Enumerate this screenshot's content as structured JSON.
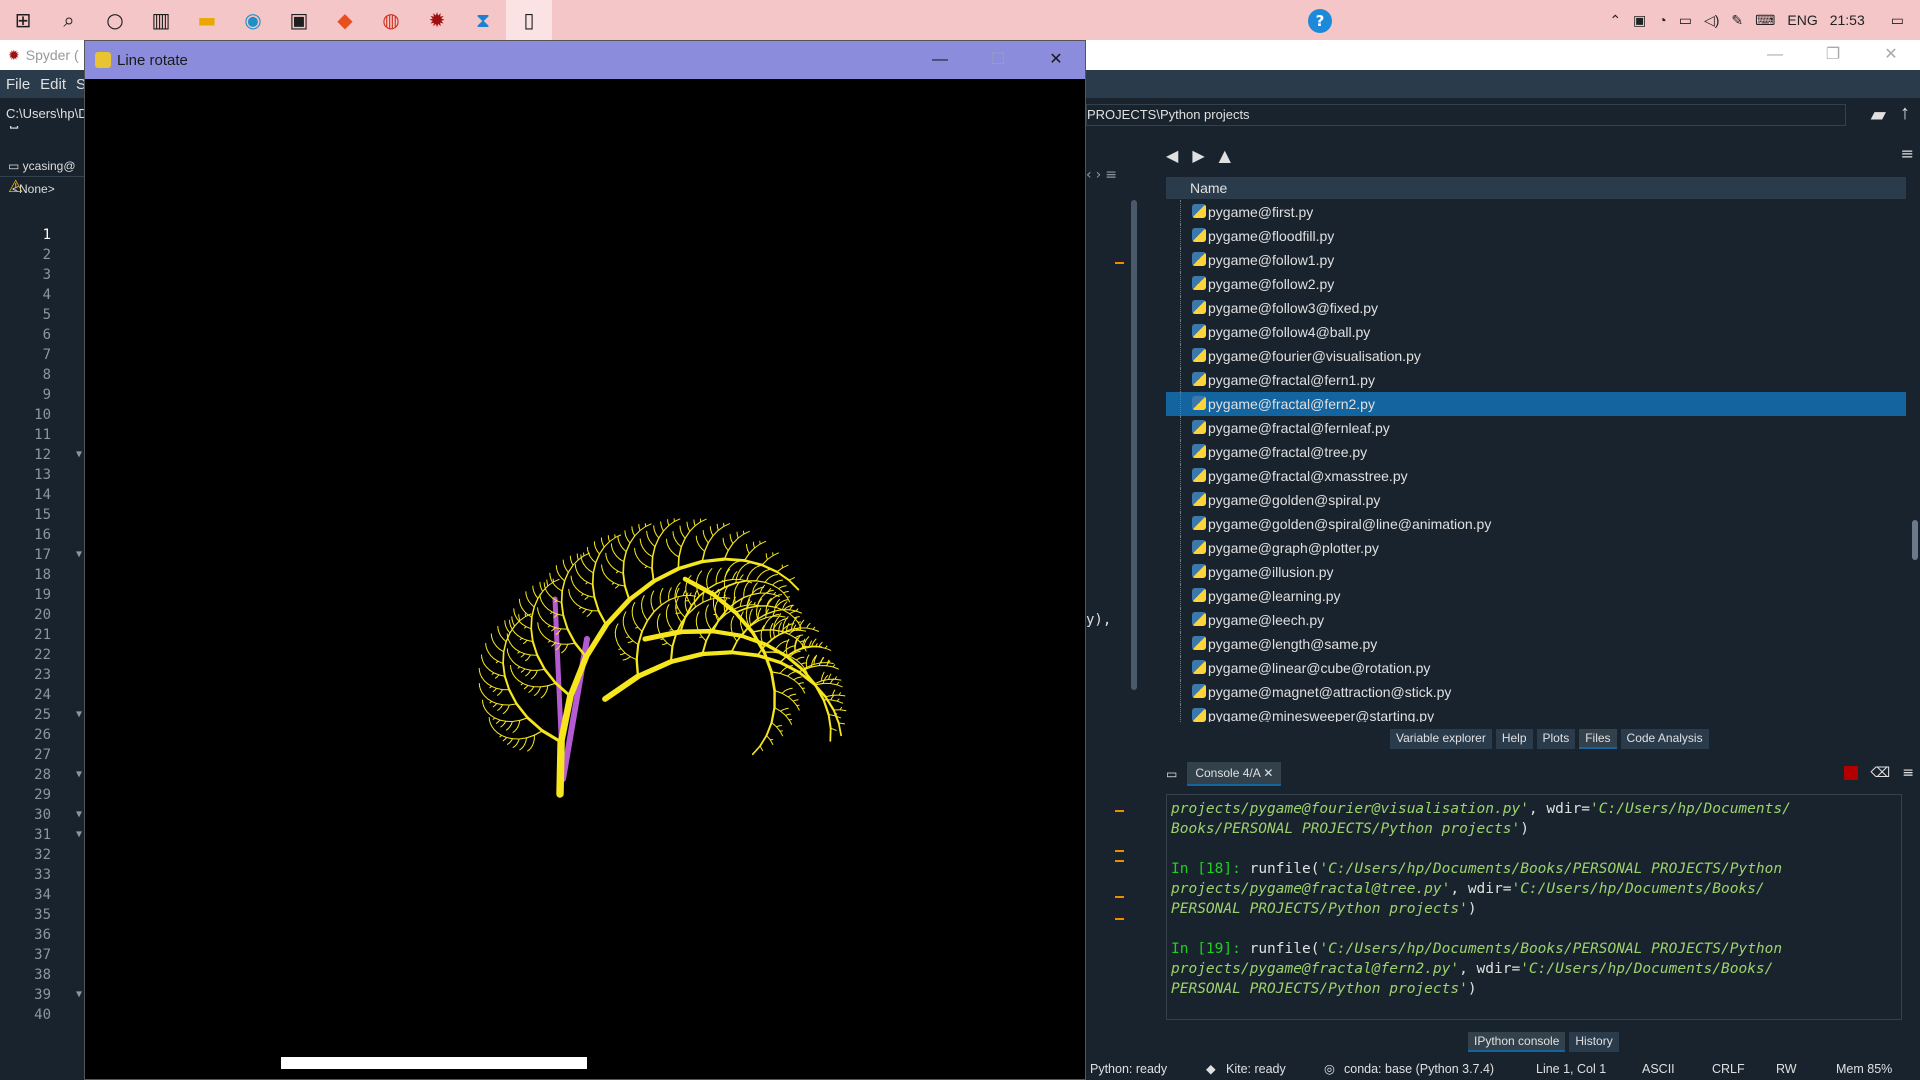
{
  "taskbar": {
    "icons": [
      "windows-start",
      "search",
      "cortana",
      "task-view",
      "file-explorer",
      "edge",
      "store",
      "brave",
      "chrome",
      "pygame-app",
      "vscode",
      "notepad"
    ],
    "tray": {
      "lang": "ENG",
      "time": "21:53"
    }
  },
  "spyder": {
    "title": "Spyder (",
    "menu": [
      "File",
      "Edit",
      "Se"
    ],
    "path_left": "C:\\Users\\hp\\D",
    "path_right": "PROJECTS\\Python projects",
    "editor_tab": "ycasing@",
    "editor_none": "<None>",
    "code_fragment": "y),",
    "line_numbers": [
      "1",
      "2",
      "3",
      "4",
      "5",
      "6",
      "7",
      "8",
      "9",
      "10",
      "11",
      "12",
      "13",
      "14",
      "15",
      "16",
      "17",
      "18",
      "19",
      "20",
      "21",
      "22",
      "23",
      "24",
      "25",
      "26",
      "27",
      "28",
      "29",
      "30",
      "31",
      "32",
      "33",
      "34",
      "35",
      "36",
      "37",
      "38",
      "39",
      "40"
    ]
  },
  "files": {
    "header": "Name",
    "items": [
      "pygame@first.py",
      "pygame@floodfill.py",
      "pygame@follow1.py",
      "pygame@follow2.py",
      "pygame@follow3@fixed.py",
      "pygame@follow4@ball.py",
      "pygame@fourier@visualisation.py",
      "pygame@fractal@fern1.py",
      "pygame@fractal@fern2.py",
      "pygame@fractal@fernleaf.py",
      "pygame@fractal@tree.py",
      "pygame@fractal@xmasstree.py",
      "pygame@golden@spiral.py",
      "pygame@golden@spiral@line@animation.py",
      "pygame@graph@plotter.py",
      "pygame@illusion.py",
      "pygame@learning.py",
      "pygame@leech.py",
      "pygame@length@same.py",
      "pygame@linear@cube@rotation.py",
      "pygame@magnet@attraction@stick.py",
      "pygame@minesweeper@starting.py"
    ],
    "selected_index": 8
  },
  "pane_tabs": [
    "Variable explorer",
    "Help",
    "Plots",
    "Files",
    "Code Analysis"
  ],
  "console": {
    "tab": "Console 4/A",
    "lines": [
      {
        "type": "cont",
        "a": "projects/pygame@fourier@visualisation.py'",
        "b": ", wdir=",
        "c": "'C:/Users/hp/Documents/"
      },
      {
        "type": "str",
        "a": "Books/PERSONAL PROJECTS/Python projects'",
        "b": ")"
      },
      {
        "type": "blank"
      },
      {
        "type": "in",
        "n": "18",
        "a": "runfile(",
        "b": "'C:/Users/hp/Documents/Books/PERSONAL PROJECTS/Python"
      },
      {
        "type": "cont",
        "a": "projects/pygame@fractal@tree.py'",
        "b": ", wdir=",
        "c": "'C:/Users/hp/Documents/Books/"
      },
      {
        "type": "str",
        "a": "PERSONAL PROJECTS/Python projects'",
        "b": ")"
      },
      {
        "type": "blank"
      },
      {
        "type": "in",
        "n": "19",
        "a": "runfile(",
        "b": "'C:/Users/hp/Documents/Books/PERSONAL PROJECTS/Python"
      },
      {
        "type": "cont",
        "a": "projects/pygame@fractal@fern2.py'",
        "b": ", wdir=",
        "c": "'C:/Users/hp/Documents/Books/"
      },
      {
        "type": "str",
        "a": "PERSONAL PROJECTS/Python projects'",
        "b": ")"
      }
    ],
    "bottom_tabs": [
      "IPython console",
      "History"
    ]
  },
  "status": {
    "python": "Python: ready",
    "kite": "Kite: ready",
    "conda": "conda: base (Python 3.7.4)",
    "cursor": "Line 1, Col 1",
    "encoding": "ASCII",
    "eol": "CRLF",
    "rw": "RW",
    "mem": "Mem 85%"
  },
  "pygame_window": {
    "title": "Line rotate",
    "fractal_color": "#f5e61e",
    "accent_color": "#b45ad2"
  }
}
